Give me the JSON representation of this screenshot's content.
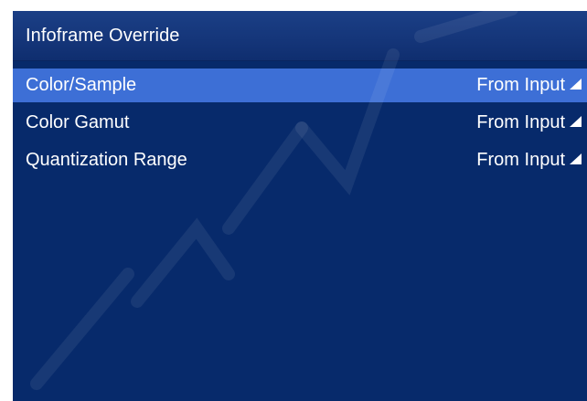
{
  "panel": {
    "title": "Infoframe Override"
  },
  "menu": {
    "rows": [
      {
        "label": "Color/Sample",
        "value": "From Input",
        "selected": true
      },
      {
        "label": "Color Gamut",
        "value": "From Input",
        "selected": false
      },
      {
        "label": "Quantization Range",
        "value": "From Input",
        "selected": false
      }
    ]
  },
  "icons": {
    "value_arrow": "triangle-arrow-icon"
  },
  "colors": {
    "panel_background": "#072a6b",
    "header_background": "#15367a",
    "selected_row": "#3d6fd6",
    "text": "#ffffff"
  }
}
